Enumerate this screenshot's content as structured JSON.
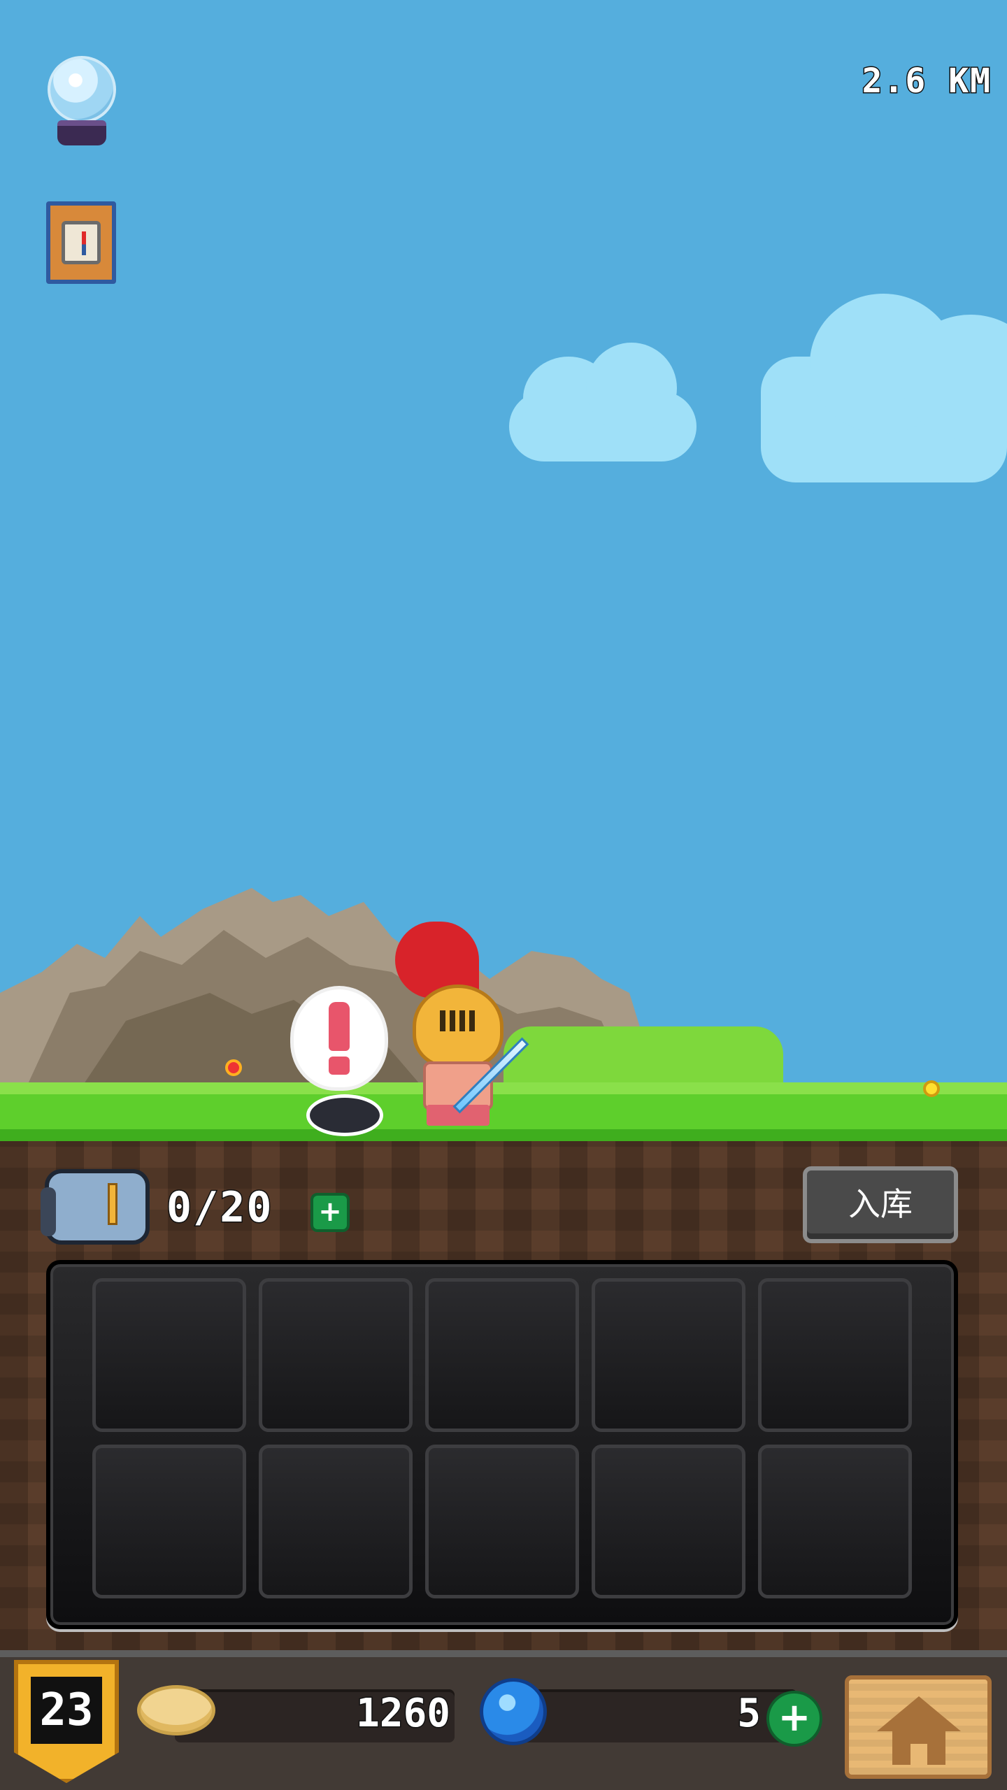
{
  "hud": {
    "distance": "2.6 KM"
  },
  "icons": {
    "crystal_ball": "crystal-ball-icon",
    "compass": "compass-icon",
    "backpack": "backpack-icon",
    "gold": "gold-coin-icon",
    "gem": "blue-gem-icon",
    "home": "home-icon",
    "quest": "exclamation-icon"
  },
  "inventory": {
    "capacity": "0/20",
    "expand_label": "+",
    "store_button": "入库",
    "slots_visible": 10,
    "slots_filled": 0
  },
  "bottom_bar": {
    "level": "23",
    "gold": "1260",
    "gems": "5",
    "add_gems_label": "+"
  },
  "colors": {
    "sky": "#55aedd",
    "grass": "#5ecf2c",
    "dirt": "#5a3d2b",
    "badge_gold": "#f2b22a",
    "add_button_green": "#1a9a48"
  }
}
